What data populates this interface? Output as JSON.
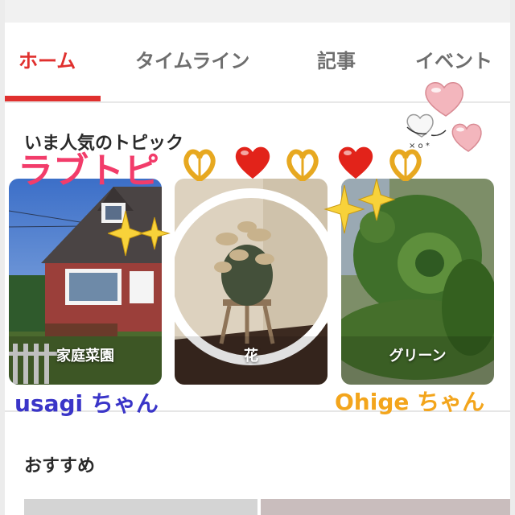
{
  "tabs": [
    {
      "label": "ホーム",
      "active": true
    },
    {
      "label": "タイムライン",
      "active": false
    },
    {
      "label": "記事",
      "active": false
    },
    {
      "label": "イベント",
      "active": false
    }
  ],
  "popular_topics": {
    "title": "いま人気のトピック",
    "cards": [
      {
        "label": "家庭菜園"
      },
      {
        "label": "花"
      },
      {
        "label": "グリーン"
      }
    ]
  },
  "overlay": {
    "heading": "ラブトピ",
    "name_left": "usagi ちゃん",
    "name_right": "Ohige ちゃん"
  },
  "recommended": {
    "title": "おすすめ"
  },
  "colors": {
    "accent": "#e0302e",
    "overlay_pink": "#f23c6a",
    "name_blue": "#3a35c8",
    "name_orange": "#f3a51c"
  },
  "stickers": [
    "folded-hands-heart-icon",
    "red-heart-icon",
    "sparkles-icon",
    "pink-heart-icon"
  ]
}
